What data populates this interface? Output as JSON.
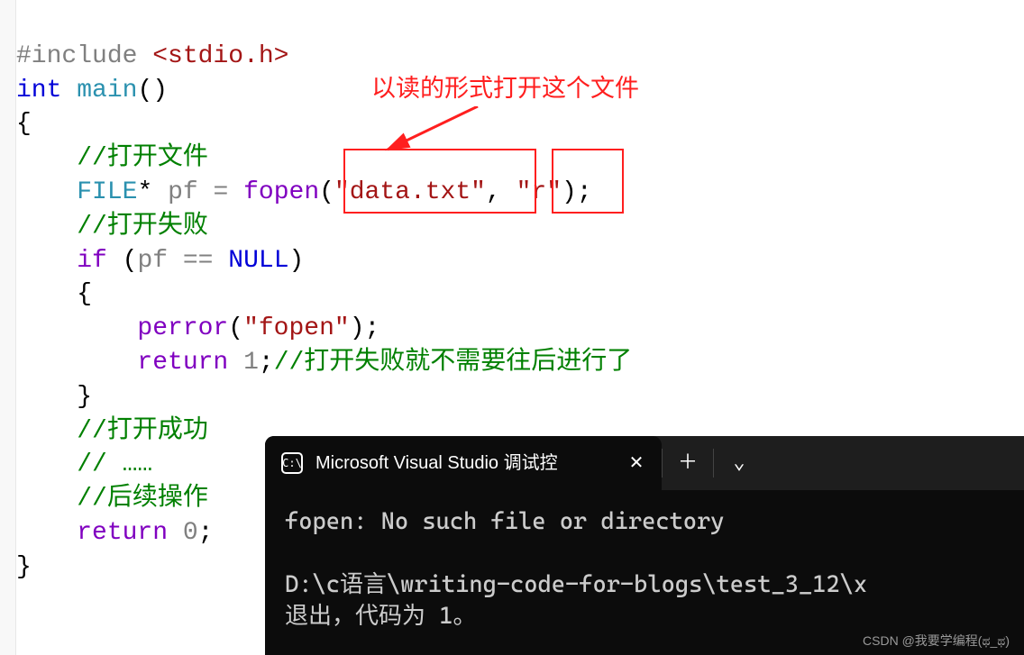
{
  "code": {
    "line1": {
      "include": "#include",
      "header": "<stdio.h>"
    },
    "line2": {
      "kw_int": "int",
      "fn_main": "main",
      "parens": "()"
    },
    "line3": "{",
    "line4": {
      "comment": "//打开文件"
    },
    "line5": {
      "type": "FILE",
      "star": "*",
      "var": "pf",
      "eq": "=",
      "fn": "fopen",
      "lparen": "(",
      "arg1": "\"data.txt\"",
      "comma": ",",
      "arg2": "\"r\"",
      "rparen": ")",
      "semi": ";"
    },
    "line6": {
      "comment": "//打开失败"
    },
    "line7": {
      "kw_if": "if",
      "lparen": "(",
      "var": "pf",
      "eqeq": "==",
      "null": "NULL",
      "rparen": ")"
    },
    "line8": "{",
    "line9": {
      "fn": "perror",
      "lparen": "(",
      "arg": "\"fopen\"",
      "rparen": ")",
      "semi": ";"
    },
    "line10": {
      "kw_return": "return",
      "val": "1",
      "semi": ";",
      "comment": "//打开失败就不需要往后进行了"
    },
    "line11": "}",
    "line12": {
      "comment": "//打开成功"
    },
    "line13": {
      "comment": "// ……"
    },
    "line14": {
      "comment": "//后续操作"
    },
    "line15": {
      "kw_return": "return",
      "val": "0",
      "semi": ";"
    },
    "line16": "}"
  },
  "annotation": "以读的形式打开这个文件",
  "console": {
    "tab": {
      "icon_name": "terminal-icon",
      "title": "Microsoft Visual Studio 调试控",
      "close_label": "✕"
    },
    "new_tab": "＋",
    "dropdown": "⌄",
    "output": {
      "line1": "fopen: No such file or directory",
      "line2": "",
      "line3": "D:\\c语言\\writing-code-for-blogs\\test_3_12\\x",
      "line4": "退出，代码为 1。"
    }
  },
  "watermark": "CSDN @我要学编程(ಥ_ಥ)"
}
